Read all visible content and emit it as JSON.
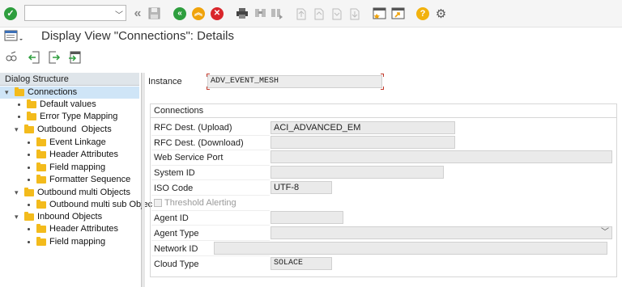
{
  "toolbar": {
    "command_field_value": "",
    "icons": [
      "enter-check-icon",
      "back-double-arrow-icon",
      "save-icon",
      "back-icon",
      "exit-icon",
      "cancel-icon",
      "print-icon",
      "find-icon",
      "find-next-icon",
      "first-page-icon",
      "previous-page-icon",
      "next-page-icon",
      "last-page-icon",
      "new-session-icon",
      "shortcut-icon",
      "help-icon",
      "settings-icon"
    ]
  },
  "title": "Display View \"Connections\": Details",
  "app_toolbar": {
    "icons": [
      "display-change-icon",
      "previous-entry-icon",
      "next-entry-icon",
      "other-entry-icon"
    ]
  },
  "dialog_structure": {
    "header": "Dialog Structure",
    "items": [
      {
        "label": "Connections",
        "level": 0,
        "expanded": true,
        "selected": true
      },
      {
        "label": "Default values",
        "level": 1
      },
      {
        "label": "Error Type Mapping",
        "level": 1
      },
      {
        "label": "Outbound  Objects",
        "level": 1,
        "expanded": true
      },
      {
        "label": "Event Linkage",
        "level": 2
      },
      {
        "label": "Header Attributes",
        "level": 2
      },
      {
        "label": "Field mapping",
        "level": 2
      },
      {
        "label": "Formatter Sequence",
        "level": 2
      },
      {
        "label": "Outbound multi Objects",
        "level": 1,
        "expanded": true
      },
      {
        "label": "Outbound multi sub Objec",
        "level": 2
      },
      {
        "label": "Inbound Objects",
        "level": 1,
        "expanded": true
      },
      {
        "label": "Header Attributes",
        "level": 2
      },
      {
        "label": "Field mapping",
        "level": 2
      }
    ]
  },
  "instance": {
    "label": "Instance",
    "value": "ADV_EVENT_MESH"
  },
  "connections": {
    "title": "Connections",
    "fields": [
      {
        "label": "RFC Dest. (Upload)",
        "value": "ACI_ADVANCED_EM"
      },
      {
        "label": "RFC Dest. (Download)",
        "value": ""
      },
      {
        "label": "Web Service Port",
        "value": ""
      },
      {
        "label": "System ID",
        "value": ""
      },
      {
        "label": "ISO Code",
        "value": "UTF-8"
      },
      {
        "label": "Threshold Alerting",
        "value": "unchecked"
      },
      {
        "label": "Agent ID",
        "value": ""
      },
      {
        "label": "Agent Type",
        "value": ""
      },
      {
        "label": "Network ID",
        "value": ""
      },
      {
        "label": "Cloud Type",
        "value": "SOLACE"
      }
    ]
  },
  "colors": {
    "green": "#2e9e3e",
    "orange": "#f0a30a",
    "red": "#d9262b",
    "folder": "#f3bb1c",
    "selection": "#cfe5f7",
    "help": "#f2b20d"
  }
}
